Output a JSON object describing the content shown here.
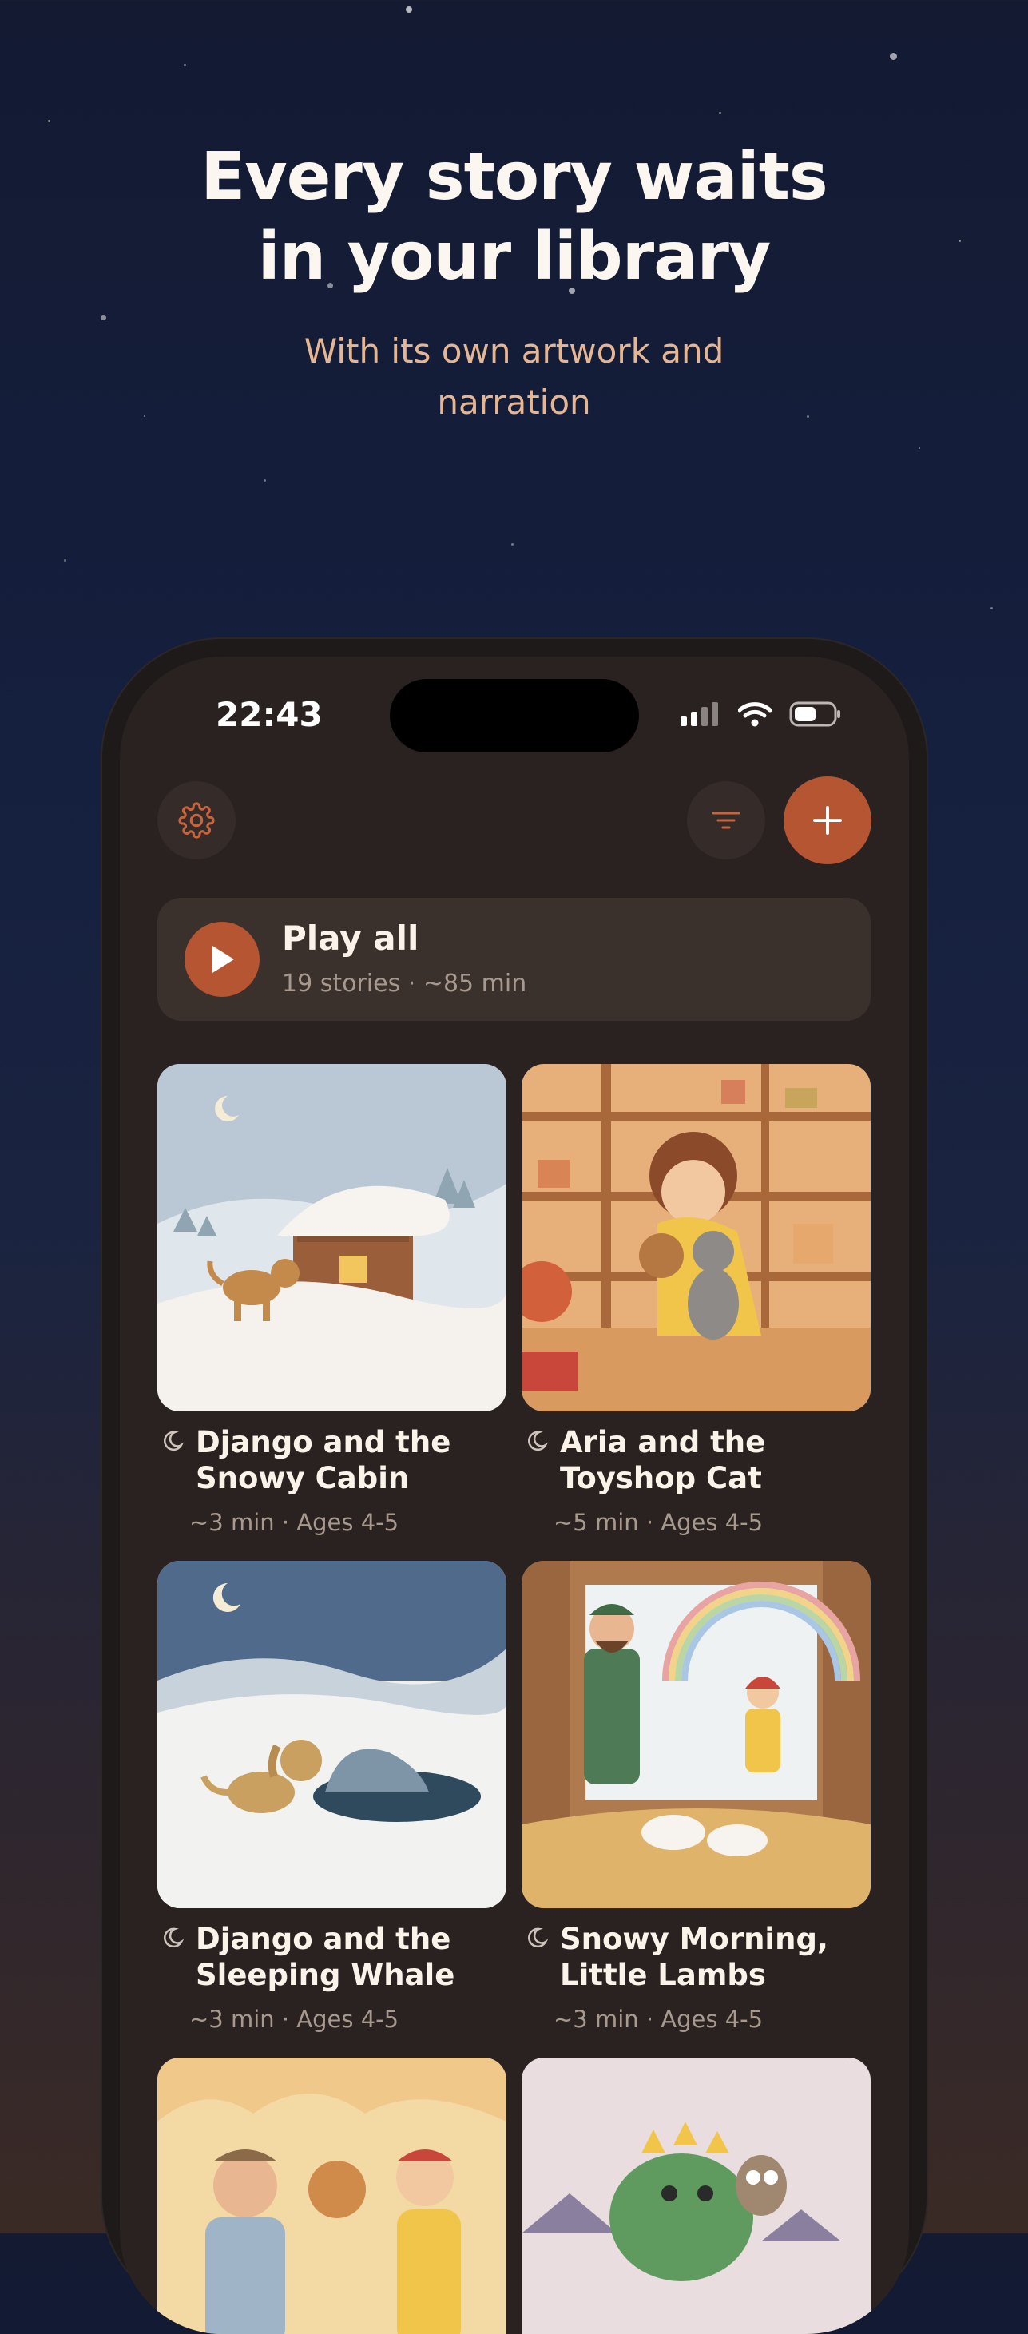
{
  "hero": {
    "title_line1": "Every story waits",
    "title_line2": "in your library",
    "subtitle_line1": "With its own artwork and",
    "subtitle_line2": "narration"
  },
  "status_bar": {
    "time": "22:43",
    "icons": [
      "cellular-signal-icon",
      "wifi-icon",
      "battery-icon"
    ]
  },
  "toolbar": {
    "settings_icon": "gear-icon",
    "sort_icon": "filter-lines-icon",
    "add_icon": "plus-icon"
  },
  "play_all": {
    "title": "Play all",
    "subtitle": "19 stories · ~85 min",
    "icon": "play-icon"
  },
  "stories": [
    {
      "title_line1": "Django and the",
      "title_line2": "Snowy Cabin",
      "meta": "~3 min · Ages 4-5",
      "icon": "moon-icon"
    },
    {
      "title_line1": "Aria and the",
      "title_line2": "Toyshop Cat",
      "meta": "~5 min · Ages 4-5",
      "icon": "moon-icon"
    },
    {
      "title_line1": "Django and the",
      "title_line2": "Sleeping Whale",
      "meta": "~3 min · Ages 4-5",
      "icon": "moon-icon"
    },
    {
      "title_line1": "Snowy Morning,",
      "title_line2": "Little Lambs",
      "meta": "~3 min · Ages 4-5",
      "icon": "moon-icon"
    }
  ],
  "colors": {
    "accent": "#b65532",
    "background_top": "#131a32",
    "screen_bg": "#2a2220",
    "card_bg": "#3a302c"
  }
}
